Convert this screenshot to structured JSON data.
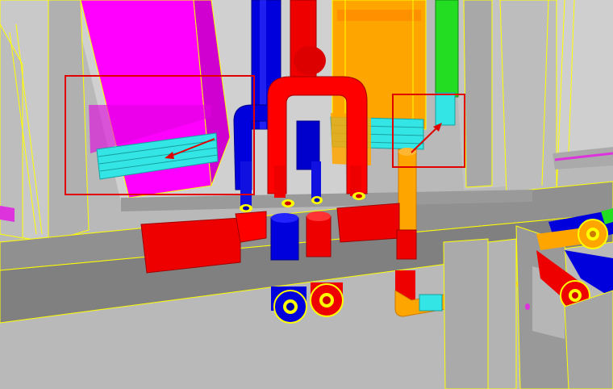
{
  "viewport": {
    "kind": "3d-model-view",
    "description_label": ""
  },
  "colors": {
    "background_wall": "#b7b7b7",
    "ceiling": "#c8c8c8",
    "floor_band": "#8c8c8c",
    "edge": "#ffff00",
    "duct_magenta": "#ff00ff",
    "duct_orange": "#ffa500",
    "pipe_red": "#ff0000",
    "pipe_blue": "#0000dd",
    "pipe_green": "#22dd22",
    "pipe_cyan": "#33e5e5",
    "annotation": "#e00000"
  },
  "annotations": [
    {
      "id": "box-left",
      "shape": "rectangle",
      "target": "magenta-duct-cyan-grille"
    },
    {
      "id": "box-right",
      "shape": "rectangle",
      "target": "green-pipe-cyan-collar"
    }
  ]
}
